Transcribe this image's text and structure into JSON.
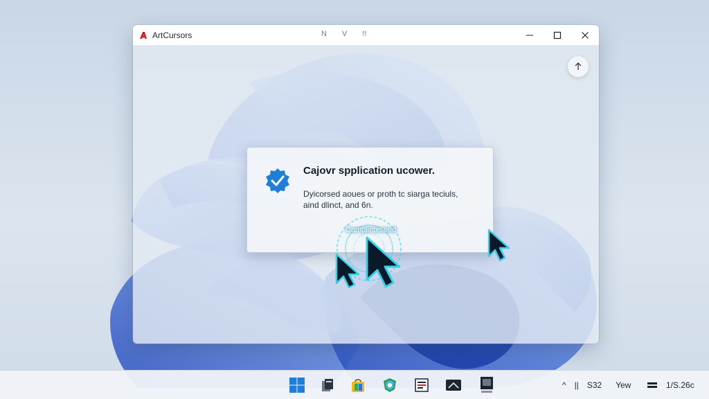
{
  "window": {
    "title": "ArtCursors",
    "toolbar_glyphs": [
      "Ν",
      "V",
      "!!"
    ],
    "controls": {
      "minimize": "minimize-icon",
      "maximize": "maximize-icon",
      "close": "close-icon"
    }
  },
  "dialog": {
    "title": "Cajovr spplication ucower.",
    "body_line_1": "Dyicorsed aoues or proth tc siarga teciuls,",
    "body_line_2": "aind dlinct, and 6n.",
    "action_label": "Camplinteseed",
    "icon": "checkmark-icon"
  },
  "taskbar": {
    "tray_label_1": "S32",
    "tray_label_2": "Yew",
    "clock": "1/S.26c",
    "tray_glyphs": [
      "^",
      "||",
      "≡"
    ]
  },
  "colors": {
    "accent": "#1f7fd6",
    "wallpaper_blue": "#3b6fe0",
    "cursor_fill": "#0b1a2a",
    "cursor_glow": "#39d0e6"
  }
}
